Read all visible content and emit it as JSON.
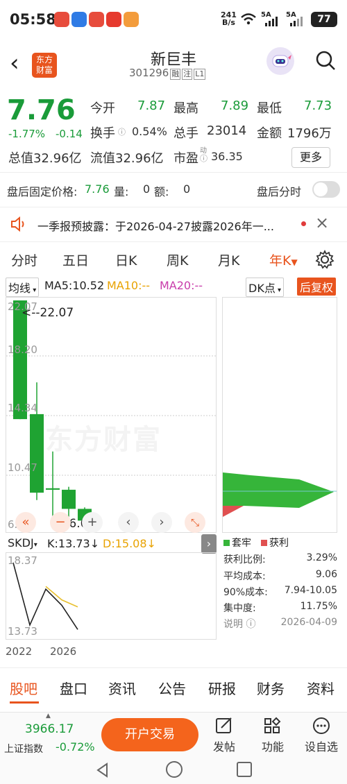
{
  "status_bar": {
    "time": "05:58",
    "net_speed_top": "241",
    "net_speed_bottom": "B/s",
    "sim1": "5A",
    "sim2": "5A",
    "battery": "77"
  },
  "header": {
    "logo_line1": "东方",
    "logo_line2": "财富",
    "name": "新巨丰",
    "code": "301296",
    "tags": [
      "融",
      "注",
      "L1"
    ]
  },
  "quote": {
    "price": "7.76",
    "pct": "-1.77%",
    "change": "-0.14",
    "open_label": "今开",
    "open": "7.87",
    "high_label": "最高",
    "high": "7.89",
    "low_label": "最低",
    "low": "7.73",
    "turnover_label": "换手",
    "turnover": "0.54%",
    "volume_label": "总手",
    "volume": "23014",
    "amount_label": "金额",
    "amount": "1796万",
    "total_cap": "总值32.96亿",
    "float_cap": "流值32.96亿",
    "pe_label": "市盈",
    "pe_sup": "动",
    "pe": "36.35",
    "more": "更多"
  },
  "after_hours": {
    "label": "盘后固定价格:",
    "price": "7.76",
    "vol_label": "量:",
    "vol": "0",
    "amt_label": "额:",
    "amt": "0",
    "switch_label": "盘后分时"
  },
  "notice": {
    "text": "一季报预披露：于2026-04-27披露2026年一..."
  },
  "chart_tabs": {
    "items": [
      "分时",
      "五日",
      "日K",
      "周K",
      "月K"
    ],
    "active": "年K"
  },
  "indicators": {
    "main": "均线",
    "ma5": "MA5:10.52",
    "ma10": "MA10:--",
    "ma20": "MA20:--",
    "dk": "DK点",
    "fq": "后复权"
  },
  "kline": {
    "ylabels": [
      "22.07",
      "18.20",
      "14.34",
      "10.47",
      "6.60"
    ],
    "max_label": "<--22.07",
    "min_label": "<-6.60",
    "watermark": "东方财富",
    "colors": {
      "up": "#e03b3b",
      "down": "#1fa332"
    }
  },
  "chart_data": [
    {
      "type": "candlestick",
      "title": "年K",
      "ylim": [
        6.6,
        22.07
      ],
      "candles": [
        {
          "open": 22.07,
          "close": 14.0,
          "high": 22.07,
          "low": 14.0
        },
        {
          "open": 14.34,
          "close": 9.0,
          "high": 16.5,
          "low": 8.5
        },
        {
          "open": 9.3,
          "close": 9.2,
          "high": 11.8,
          "low": 7.0
        },
        {
          "open": 9.2,
          "close": 7.9,
          "high": 9.4,
          "low": 7.2
        },
        {
          "open": 7.9,
          "close": 7.1,
          "high": 8.0,
          "low": 6.6
        }
      ]
    },
    {
      "type": "line",
      "title": "SKDJ",
      "x_labels": [
        "2022",
        "2026"
      ],
      "ylim": [
        13.73,
        18.37
      ],
      "series": [
        {
          "name": "K",
          "values": [
            18.37,
            13.73,
            16.4,
            15.2,
            13.4
          ]
        },
        {
          "name": "D",
          "values": [
            null,
            null,
            16.6,
            15.6,
            15.08
          ]
        }
      ]
    }
  ],
  "skdj": {
    "name": "SKDJ",
    "k": "K:13.73",
    "k_arrow": "↓",
    "d": "D:15.08",
    "d_arrow": "↓",
    "ymax": "18.37",
    "ymin": "13.73",
    "x_start": "2022",
    "x_end": "2026"
  },
  "distribution": {
    "legend_trapped": "套牢",
    "legend_profit": "获利",
    "rows": [
      {
        "label": "获利比例:",
        "value": "3.29%"
      },
      {
        "label": "平均成本:",
        "value": "9.06"
      },
      {
        "label": "90%成本:",
        "value": "7.94-10.05"
      },
      {
        "label": "集中度:",
        "value": "11.75%"
      }
    ],
    "note_label": "说明",
    "note_date": "2026-04-09",
    "profit_ratio": 0.0329
  },
  "bottom_tabs": [
    "股吧",
    "盘口",
    "资讯",
    "公告",
    "研报",
    "财务",
    "资料"
  ],
  "bottom_bar": {
    "index_value": "3966.17",
    "index_name": "上证指数",
    "index_pct": "-0.72%",
    "trade": "开户交易",
    "post": "发帖",
    "func": "功能",
    "custom": "设自选"
  }
}
